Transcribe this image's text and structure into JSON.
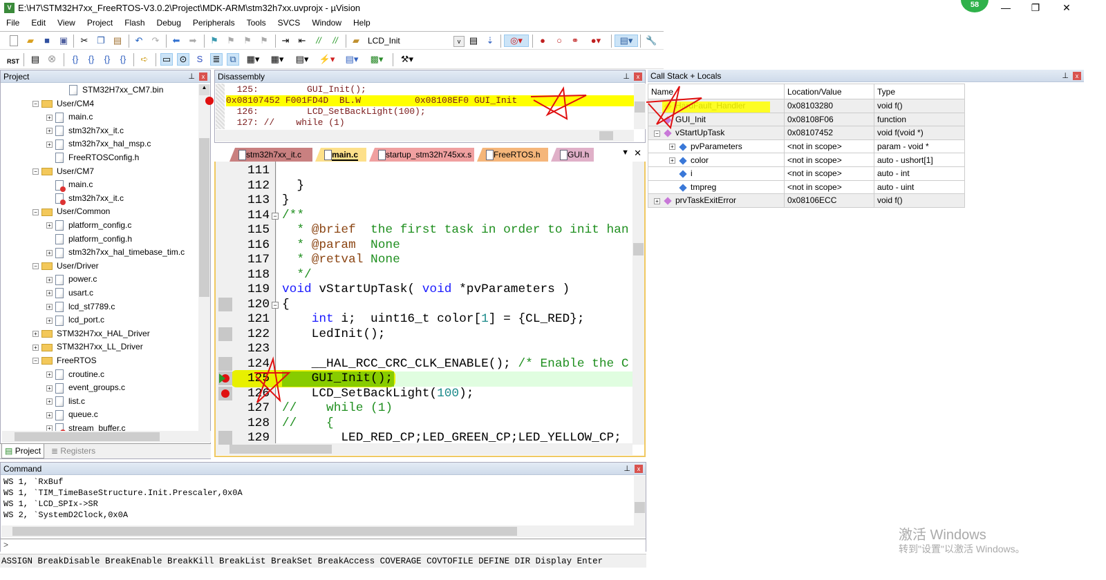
{
  "window": {
    "title": "E:\\H7\\STM32H7xx_FreeRTOS-V3.0.2\\Project\\MDK-ARM\\stm32h7xx.uvprojx - µVision",
    "app_icon": "V",
    "notification_count": "58",
    "minimize": "—",
    "restore": "❐",
    "close": "✕"
  },
  "menu": [
    "File",
    "Edit",
    "View",
    "Project",
    "Flash",
    "Debug",
    "Peripherals",
    "Tools",
    "SVCS",
    "Window",
    "Help"
  ],
  "toolbar": {
    "target": "LCD_Init",
    "rst_label": "RST"
  },
  "project": {
    "title": "Project",
    "tree": [
      {
        "label": "STM32H7xx_CM7.bin",
        "level": 3,
        "kind": "file",
        "exp": ""
      },
      {
        "label": "User/CM4",
        "level": 1,
        "kind": "folder",
        "exp": "-"
      },
      {
        "label": "main.c",
        "level": 2,
        "kind": "file",
        "exp": "+"
      },
      {
        "label": "stm32h7xx_it.c",
        "level": 2,
        "kind": "file",
        "exp": "+"
      },
      {
        "label": "stm32h7xx_hal_msp.c",
        "level": 2,
        "kind": "file",
        "exp": "+"
      },
      {
        "label": "FreeRTOSConfig.h",
        "level": 2,
        "kind": "file",
        "exp": ""
      },
      {
        "label": "User/CM7",
        "level": 1,
        "kind": "folder",
        "exp": "-"
      },
      {
        "label": "main.c",
        "level": 2,
        "kind": "file-err",
        "exp": ""
      },
      {
        "label": "stm32h7xx_it.c",
        "level": 2,
        "kind": "file-err",
        "exp": ""
      },
      {
        "label": "User/Common",
        "level": 1,
        "kind": "folder",
        "exp": "-"
      },
      {
        "label": "platform_config.c",
        "level": 2,
        "kind": "file",
        "exp": "+"
      },
      {
        "label": "platform_config.h",
        "level": 2,
        "kind": "file",
        "exp": ""
      },
      {
        "label": "stm32h7xx_hal_timebase_tim.c",
        "level": 2,
        "kind": "file",
        "exp": "+"
      },
      {
        "label": "User/Driver",
        "level": 1,
        "kind": "folder",
        "exp": "-"
      },
      {
        "label": "power.c",
        "level": 2,
        "kind": "file",
        "exp": "+"
      },
      {
        "label": "usart.c",
        "level": 2,
        "kind": "file",
        "exp": "+"
      },
      {
        "label": "lcd_st7789.c",
        "level": 2,
        "kind": "file",
        "exp": "+"
      },
      {
        "label": "lcd_port.c",
        "level": 2,
        "kind": "file",
        "exp": "+"
      },
      {
        "label": "STM32H7xx_HAL_Driver",
        "level": 1,
        "kind": "folder",
        "exp": "+"
      },
      {
        "label": "STM32H7xx_LL_Driver",
        "level": 1,
        "kind": "folder",
        "exp": "+"
      },
      {
        "label": "FreeRTOS",
        "level": 1,
        "kind": "folder",
        "exp": "-"
      },
      {
        "label": "croutine.c",
        "level": 2,
        "kind": "file",
        "exp": "+"
      },
      {
        "label": "event_groups.c",
        "level": 2,
        "kind": "file",
        "exp": "+"
      },
      {
        "label": "list.c",
        "level": 2,
        "kind": "file",
        "exp": "+"
      },
      {
        "label": "queue.c",
        "level": 2,
        "kind": "file",
        "exp": "+"
      },
      {
        "label": "stream_buffer.c",
        "level": 2,
        "kind": "file-err",
        "exp": "+"
      }
    ],
    "tabs": [
      "Project",
      "Registers"
    ]
  },
  "disassembly": {
    "title": "Disassembly",
    "lines": [
      {
        "text": "  125:         GUI_Init();",
        "current": false
      },
      {
        "text": "0x08107452 F001FD4D  BL.W          0x08108EF0 GUI_Init",
        "current": true
      },
      {
        "text": "  126:         LCD_SetBackLight(100);",
        "current": false
      },
      {
        "text": "  127: //    while (1)",
        "current": false
      }
    ]
  },
  "editor": {
    "tabs": [
      {
        "label": "stm32h7xx_it.c",
        "color": "#c98080",
        "active": false
      },
      {
        "label": "main.c",
        "color": "#fde08a",
        "active": true
      },
      {
        "label": "startup_stm32h745xx.s",
        "color": "#f0a0a0",
        "active": false
      },
      {
        "label": "FreeRTOS.h",
        "color": "#f5b67a",
        "active": false
      },
      {
        "label": "GUI.h",
        "color": "#e0b0c8",
        "active": false
      }
    ],
    "lines": [
      {
        "n": "111",
        "t": []
      },
      {
        "n": "112",
        "t": [
          [
            "p",
            "  }"
          ]
        ]
      },
      {
        "n": "113",
        "t": [
          [
            "p",
            "}"
          ]
        ]
      },
      {
        "n": "114",
        "t": [
          [
            "c",
            "/**"
          ]
        ]
      },
      {
        "n": "115",
        "t": [
          [
            "c",
            "  * "
          ],
          [
            "d",
            "@brief"
          ],
          [
            "c",
            "  the first task in order to init han"
          ]
        ]
      },
      {
        "n": "116",
        "t": [
          [
            "c",
            "  * "
          ],
          [
            "d",
            "@param"
          ],
          [
            "c",
            "  None"
          ]
        ]
      },
      {
        "n": "117",
        "t": [
          [
            "c",
            "  * "
          ],
          [
            "d",
            "@retval"
          ],
          [
            "c",
            " None"
          ]
        ]
      },
      {
        "n": "118",
        "t": [
          [
            "c",
            "  */"
          ]
        ]
      },
      {
        "n": "119",
        "t": [
          [
            "k",
            "void"
          ],
          [
            "p",
            " vStartUpTask( "
          ],
          [
            "k",
            "void"
          ],
          [
            "p",
            " *pvParameters )"
          ]
        ]
      },
      {
        "n": "120",
        "t": [
          [
            "p",
            "{"
          ]
        ]
      },
      {
        "n": "121",
        "t": [
          [
            "p",
            "    "
          ],
          [
            "k",
            "int"
          ],
          [
            "p",
            " i;  uint16_t color["
          ],
          [
            "n",
            "1"
          ],
          [
            "p",
            "] = {CL_RED};"
          ]
        ]
      },
      {
        "n": "122",
        "t": [
          [
            "p",
            "    LedInit();"
          ]
        ]
      },
      {
        "n": "123",
        "t": []
      },
      {
        "n": "124",
        "t": [
          [
            "p",
            "    __HAL_RCC_CRC_CLK_ENABLE(); "
          ],
          [
            "c",
            "/* Enable the C"
          ]
        ]
      },
      {
        "n": "125",
        "t": [
          [
            "p",
            "    GUI_Init();"
          ]
        ]
      },
      {
        "n": "126",
        "t": [
          [
            "p",
            "    LCD_SetBackLight("
          ],
          [
            "n",
            "100"
          ],
          [
            "p",
            ");"
          ]
        ]
      },
      {
        "n": "127",
        "t": [
          [
            "c",
            "//    while (1)"
          ]
        ]
      },
      {
        "n": "128",
        "t": [
          [
            "c",
            "//    {"
          ]
        ]
      },
      {
        "n": "129",
        "t": [
          [
            "p",
            "        LED_RED_CP;LED_GREEN_CP;LED_YELLOW_CP;"
          ]
        ]
      }
    ]
  },
  "callstack": {
    "title": "Call Stack + Locals",
    "columns": [
      "Name",
      "Location/Value",
      "Type"
    ],
    "rows": [
      {
        "name": "HardFault_Handler",
        "loc": "0x08103280",
        "type": "void f()",
        "level": 0,
        "exp": "",
        "icon": "#d8822a",
        "hl": true
      },
      {
        "name": "GUI_Init",
        "loc": "0x08108F06",
        "type": "function",
        "level": 0,
        "exp": "",
        "icon": "#c878d8",
        "hl": false
      },
      {
        "name": "vStartUpTask",
        "loc": "0x08107452",
        "type": "void f(void *)",
        "level": 0,
        "exp": "-",
        "icon": "#c878d8",
        "hl": false
      },
      {
        "name": "pvParameters",
        "loc": "<not in scope>",
        "type": "param - void *",
        "level": 1,
        "exp": "+",
        "icon": "#3a78d8",
        "hl": false
      },
      {
        "name": "color",
        "loc": "<not in scope>",
        "type": "auto - ushort[1]",
        "level": 1,
        "exp": "+",
        "icon": "#3a78d8",
        "hl": false
      },
      {
        "name": "i",
        "loc": "<not in scope>",
        "type": "auto - int",
        "level": 1,
        "exp": "",
        "icon": "#3a78d8",
        "hl": false
      },
      {
        "name": "tmpreg",
        "loc": "<not in scope>",
        "type": "auto - uint",
        "level": 1,
        "exp": "",
        "icon": "#3a78d8",
        "hl": false
      },
      {
        "name": "prvTaskExitError",
        "loc": "0x08106ECC",
        "type": "void f()",
        "level": 0,
        "exp": "+",
        "icon": "#c878d8",
        "hl": false
      }
    ]
  },
  "command": {
    "title": "Command",
    "output": [
      "WS 1, `RxBuf",
      "WS 1, `TIM_TimeBaseStructure.Init.Prescaler,0x0A",
      "WS 1, `LCD_SPIx->SR",
      "WS 2, `SystemD2Clock,0x0A"
    ],
    "prompt": ">",
    "input_value": "",
    "hint": "ASSIGN BreakDisable BreakEnable BreakKill BreakList BreakSet BreakAccess COVERAGE COVTOFILE DEFINE DIR Display Enter"
  },
  "watermark": {
    "line1": "激活 Windows",
    "line2": "转到\"设置\"以激活 Windows。"
  },
  "colors": {
    "highlight_yellow": "#ffff00",
    "current_line": "#e0fde0",
    "breakpoint": "#e01010",
    "annotation": "#e01010"
  }
}
